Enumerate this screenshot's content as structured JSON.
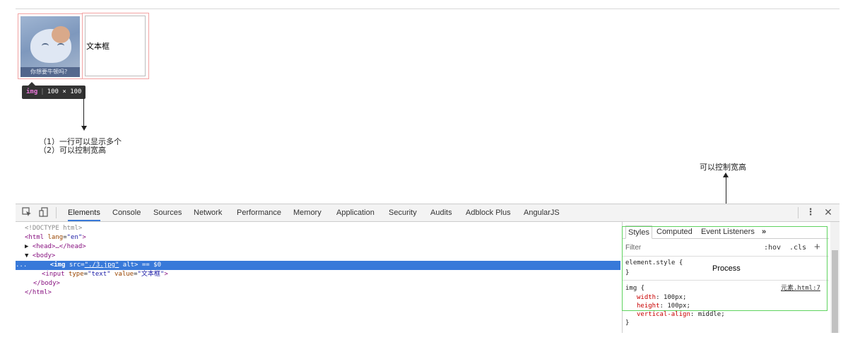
{
  "preview": {
    "image_caption": "你想要牛顿吗？",
    "input_value": "文本框",
    "tooltip_tag": "img",
    "tooltip_size": "100 × 100"
  },
  "annotations": {
    "note_line1": "（1）一行可以显示多个",
    "note_line2": "（2）可以控制宽高",
    "right_note": "可以控制宽高",
    "process_label": "Process"
  },
  "devtools": {
    "tabs": [
      "Elements",
      "Console",
      "Sources",
      "Network",
      "Performance",
      "Memory",
      "Application",
      "Security",
      "Audits",
      "Adblock Plus",
      "AngularJS"
    ],
    "active_tab": "Elements",
    "icons": {
      "inspect": "inspect-icon",
      "device": "device-toolbar-icon",
      "menu": "kebab-menu-icon",
      "close": "close-icon"
    },
    "dom": {
      "doctype": "<!DOCTYPE html>",
      "html_open_tag": "<html",
      "html_lang_attr": "lang",
      "html_lang_value": "\"en\"",
      "html_close": ">",
      "head_collapsed": "<head>…</head>",
      "body_open": "<body>",
      "img_tag": "<img",
      "img_src_attr": "src",
      "img_src_value": "\"./3.jpg\"",
      "img_alt": "alt>",
      "img_suffix": "== $0",
      "input_tag": "<input",
      "input_type_attr": "type",
      "input_type_value": "\"text\"",
      "input_value_attr": "value",
      "input_value_value": "\"文本框\"",
      "input_close": ">",
      "body_close": "</body>",
      "html_close_tag": "</html>",
      "ellipsis": "..."
    },
    "styles_panel": {
      "tabs": [
        "Styles",
        "Computed",
        "Event Listeners"
      ],
      "more": "»",
      "filter_placeholder": "Filter",
      "hov": ":hov",
      "cls": ".cls",
      "add": "+",
      "element_style_selector": "element.style {",
      "close_brace": "}",
      "rule_selector": "img {",
      "rule_source": "元素.html:7",
      "declarations": [
        {
          "prop": "width",
          "value": "100px;"
        },
        {
          "prop": "height",
          "value": "100px;"
        },
        {
          "prop": "vertical-align",
          "value": "middle;"
        }
      ]
    }
  }
}
